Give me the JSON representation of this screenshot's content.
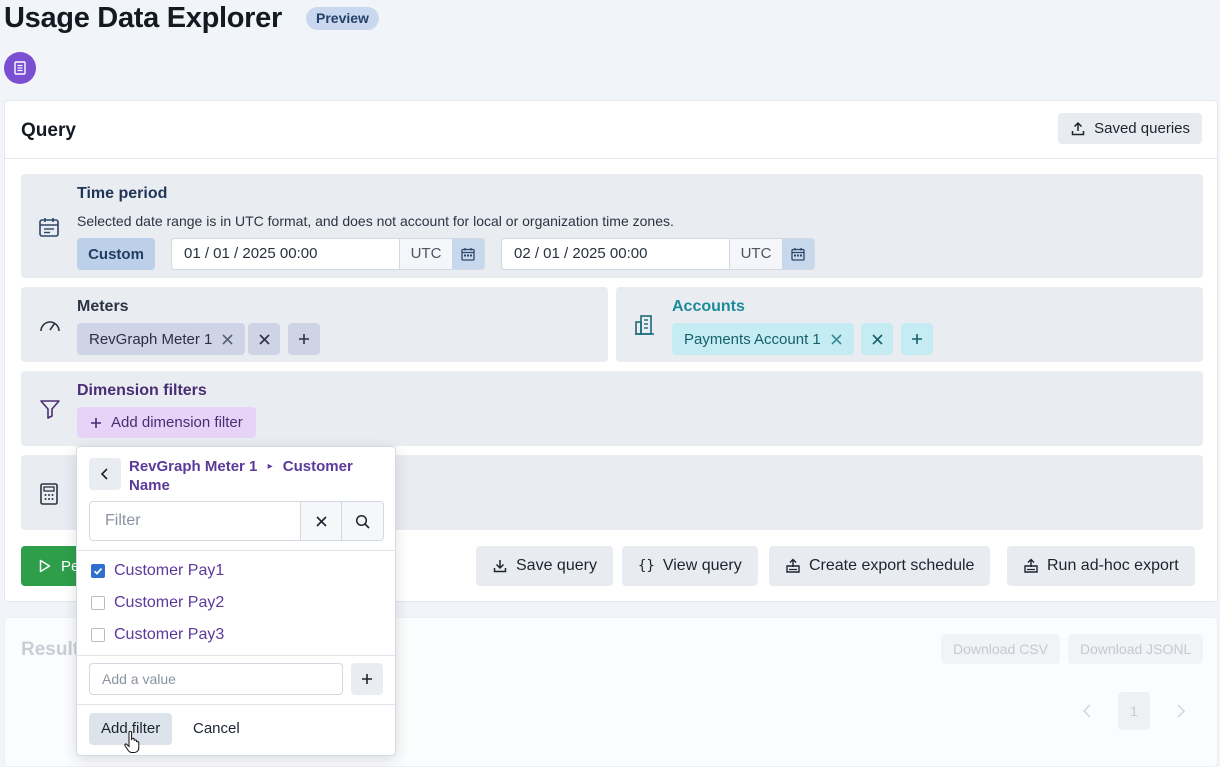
{
  "header": {
    "title": "Usage Data Explorer",
    "badge": "Preview",
    "doc_icon": "document-icon"
  },
  "query": {
    "title": "Query",
    "saved_queries_label": "Saved queries",
    "time_period": {
      "title": "Time period",
      "description": "Selected date range is in UTC format, and does not account for local or organization time zones.",
      "mode": "Custom",
      "start": "01 / 01 / 2025 00:00",
      "end": "02 / 01 / 2025 00:00",
      "timezone": "UTC"
    },
    "meters": {
      "title": "Meters",
      "chips": [
        "RevGraph Meter 1"
      ]
    },
    "accounts": {
      "title": "Accounts",
      "chips": [
        "Payments Account 1"
      ]
    },
    "dimension_filters": {
      "title": "Dimension filters",
      "add_label": "Add dimension filter"
    },
    "run_label": "Pe",
    "actions": {
      "save": "Save query",
      "view": "View query",
      "schedule": "Create export schedule",
      "adhoc": "Run ad-hoc export"
    }
  },
  "results": {
    "title": "Result",
    "download_csv": "Download CSV",
    "download_jsonl": "Download JSONL",
    "page": "1"
  },
  "popover": {
    "path_meter": "RevGraph Meter 1",
    "path_sep": "▸",
    "path_dimension": "Customer Name",
    "filter_placeholder": "Filter",
    "options": [
      {
        "label": "Customer Pay1",
        "checked": true
      },
      {
        "label": "Customer Pay2",
        "checked": false
      },
      {
        "label": "Customer Pay3",
        "checked": false
      }
    ],
    "add_value_placeholder": "Add a value",
    "add_filter_label": "Add filter",
    "cancel_label": "Cancel"
  },
  "colors": {
    "accent_purple": "#5b3a99",
    "accent_teal": "#1c8b99",
    "run_green": "#2e9e4b",
    "checkbox_blue": "#2f6fd0"
  }
}
